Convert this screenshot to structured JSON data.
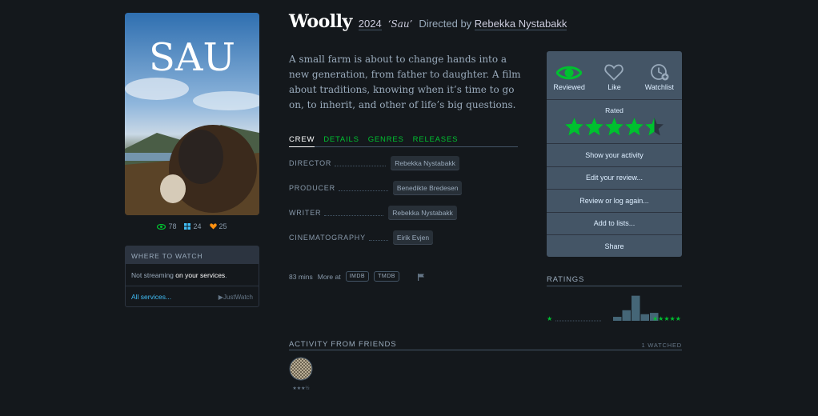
{
  "film": {
    "title": "Woolly",
    "year": "2024",
    "original_title": "‘Sau’",
    "directed_by": "Directed by",
    "director": "Rebekka Nystabakk",
    "synopsis": "A small farm is about to change hands into a new generation, from father to daughter. A film about traditions, knowing when it’s time to go on, to inherit, and other of life’s big questions."
  },
  "poster": {
    "text": "SAU"
  },
  "poster_stats": {
    "watched": "78",
    "lists": "24",
    "likes": "25"
  },
  "where_to_watch": {
    "heading": "WHERE TO WATCH",
    "text_prefix": "Not streaming ",
    "text_strong": "on your services",
    "text_suffix": ".",
    "all_services": "All services...",
    "justwatch": "JustWatch"
  },
  "tabs": [
    {
      "label": "CREW",
      "active": true
    },
    {
      "label": "DETAILS",
      "active": false
    },
    {
      "label": "GENRES",
      "active": false
    },
    {
      "label": "RELEASES",
      "active": false
    }
  ],
  "crew": [
    {
      "role": "DIRECTOR",
      "name": "Rebekka Nystabakk"
    },
    {
      "role": "PRODUCER",
      "name": "Benedikte Bredesen"
    },
    {
      "role": "WRITER",
      "name": "Rebekka Nystabakk"
    },
    {
      "role": "CINEMATOGRAPHY",
      "name": "Eirik Evjen"
    }
  ],
  "meta": {
    "runtime": "83 mins",
    "more_at": "More at",
    "imdb": "IMDB",
    "tmdb": "TMDB"
  },
  "actions": {
    "reviewed": "Reviewed",
    "like": "Like",
    "watchlist": "Watchlist",
    "rated_label": "Rated",
    "rating_value": 4.5,
    "rows": [
      "Show your activity",
      "Edit your review...",
      "Review or log again...",
      "Add to lists...",
      "Share"
    ]
  },
  "ratings": {
    "heading": "RATINGS",
    "histogram": [
      0,
      0,
      0,
      0,
      0,
      0,
      0.15,
      0.4,
      0.95,
      0.25,
      0.3
    ],
    "min_label": "★",
    "max_label": "★★★★★"
  },
  "friends": {
    "heading": "ACTIVITY FROM FRIENDS",
    "watched_count": "1 WATCHED",
    "friend_rating": "★★★½"
  },
  "colors": {
    "background": "#14181c",
    "accent_green": "#00c030",
    "panel": "#445566",
    "link_blue": "#40bcf4",
    "like_orange": "#ff9010"
  }
}
